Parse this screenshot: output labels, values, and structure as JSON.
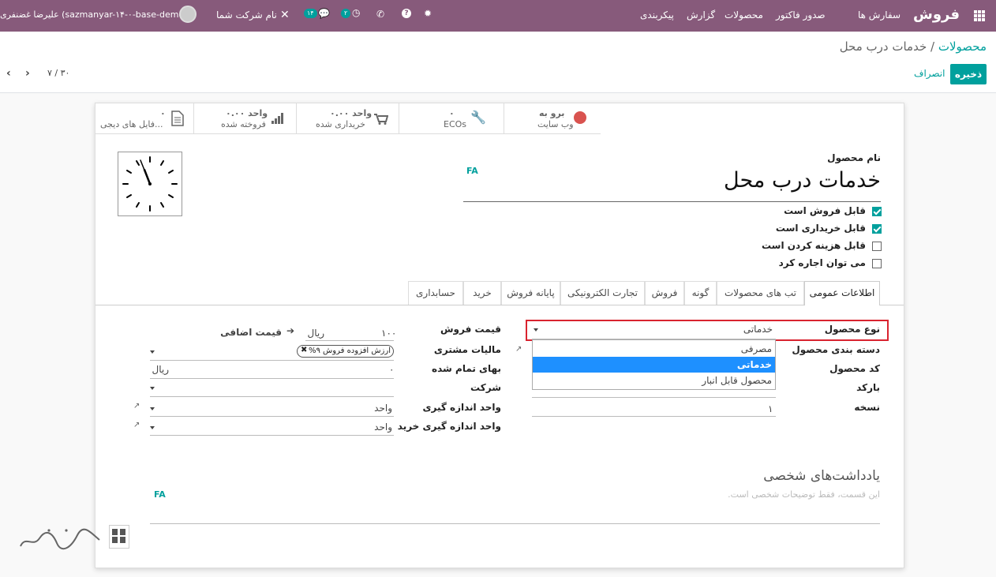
{
  "navbar": {
    "app_name": "فروش",
    "menu": [
      "سفارش ها",
      "صدور فاکتور",
      "محصولات",
      "گزارش",
      "پیکربندی"
    ],
    "chat_count": "۱۴",
    "activity_count": "۲",
    "company": "نام شرکت شما",
    "user": "علیرضا غضنفری (sazmanyar-۱۴-۰-base-demo)"
  },
  "control": {
    "breadcrumb_parent": "محصولات",
    "breadcrumb_sep": "/",
    "breadcrumb_current": "خدمات درب محل",
    "save": "ذخیره",
    "discard": "انصراف",
    "pager": "۷ / ۳۰"
  },
  "smart_buttons": [
    {
      "l1": "برو به",
      "l2": "وب سایت",
      "icon": "globe-icon"
    },
    {
      "l1": "۰",
      "l2": "ECOs",
      "icon": "wrench-icon"
    },
    {
      "l1": "۰.۰۰ واحد",
      "l2": "خریداری شده",
      "icon": "cart-icon"
    },
    {
      "l1": "۰.۰۰ واحد",
      "l2": "فروخته شده",
      "icon": "bar-chart-icon"
    },
    {
      "l1": "۰",
      "l2": "فایل های دیجی...",
      "icon": "file-icon"
    }
  ],
  "product": {
    "name_label": "نام محصول",
    "name": "خدمات درب محل",
    "lang": "FA",
    "options": [
      {
        "label": "قابل فروش است",
        "checked": true
      },
      {
        "label": "قابل خریداری است",
        "checked": true
      },
      {
        "label": "قابل هزینه کردن است",
        "checked": false
      },
      {
        "label": "می توان اجاره کرد",
        "checked": false
      }
    ]
  },
  "tabs": [
    "اطلاعات عمومی",
    "تب های محصولات",
    "گونه",
    "فروش",
    "تجارت الکترونیکی",
    "پایانه فروش",
    "خرید",
    "حسابداری"
  ],
  "left_fields": {
    "product_type_label": "نوع محصول",
    "product_type_value": "خدماتی",
    "category_label": "دسته بندی محصول",
    "code_label": "کد محصول",
    "barcode_label": "بارکد",
    "version_label": "نسخه",
    "version_value": "۱"
  },
  "dropdown_options": [
    "مصرفی",
    "خدماتی",
    "محصول قابل انبار"
  ],
  "right_fields": {
    "sale_price_label": "قیمت فروش",
    "sale_price_value": "۱۰۰",
    "sale_price_currency": "ریال",
    "extra_price": "قیمت اضافی",
    "customer_tax_label": "مالیات مشتری",
    "customer_tax_tag": "ارزش افزوده فروش ۹%",
    "cost_label": "بهای تمام شده",
    "cost_value": "۰",
    "cost_currency": "ریال",
    "company_label": "شرکت",
    "uom_label": "واحد اندازه گیری",
    "uom_value": "واحد",
    "purchase_uom_label": "واحد اندازه گیری خرید",
    "purchase_uom_value": "واحد"
  },
  "notes": {
    "title": "یادداشت‌های شخصی",
    "placeholder": "این قسمت، فقط توضیحات شخصی است.",
    "lang": "FA"
  }
}
